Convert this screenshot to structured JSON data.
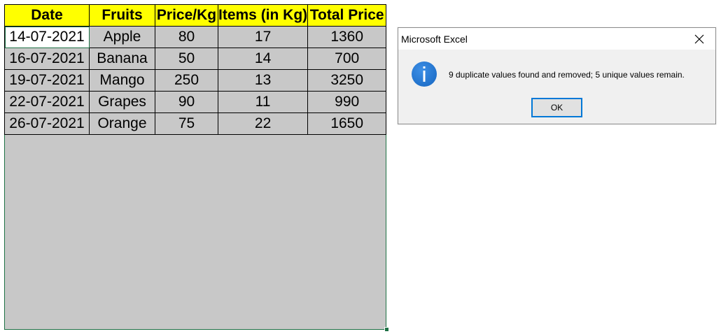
{
  "sheet": {
    "headers": [
      "Date",
      "Fruits",
      "Price/Kg",
      "Items (in Kg)",
      "Total Price"
    ],
    "rows": [
      [
        "14-07-2021",
        "Apple",
        "80",
        "17",
        "1360"
      ],
      [
        "16-07-2021",
        "Banana",
        "50",
        "14",
        "700"
      ],
      [
        "19-07-2021",
        "Mango",
        "250",
        "13",
        "3250"
      ],
      [
        "22-07-2021",
        "Grapes",
        "90",
        "11",
        "990"
      ],
      [
        "26-07-2021",
        "Orange",
        "75",
        "22",
        "1650"
      ]
    ],
    "header_color": "#ffff00",
    "selection_fill": "#c8c8c8",
    "selection_border": "#1e7145"
  },
  "dialog": {
    "title": "Microsoft Excel",
    "message": "9 duplicate values found and removed; 5 unique values remain.",
    "ok_label": "OK",
    "icon": "info-icon",
    "close_icon": "close-icon",
    "accent": "#0078d7"
  }
}
